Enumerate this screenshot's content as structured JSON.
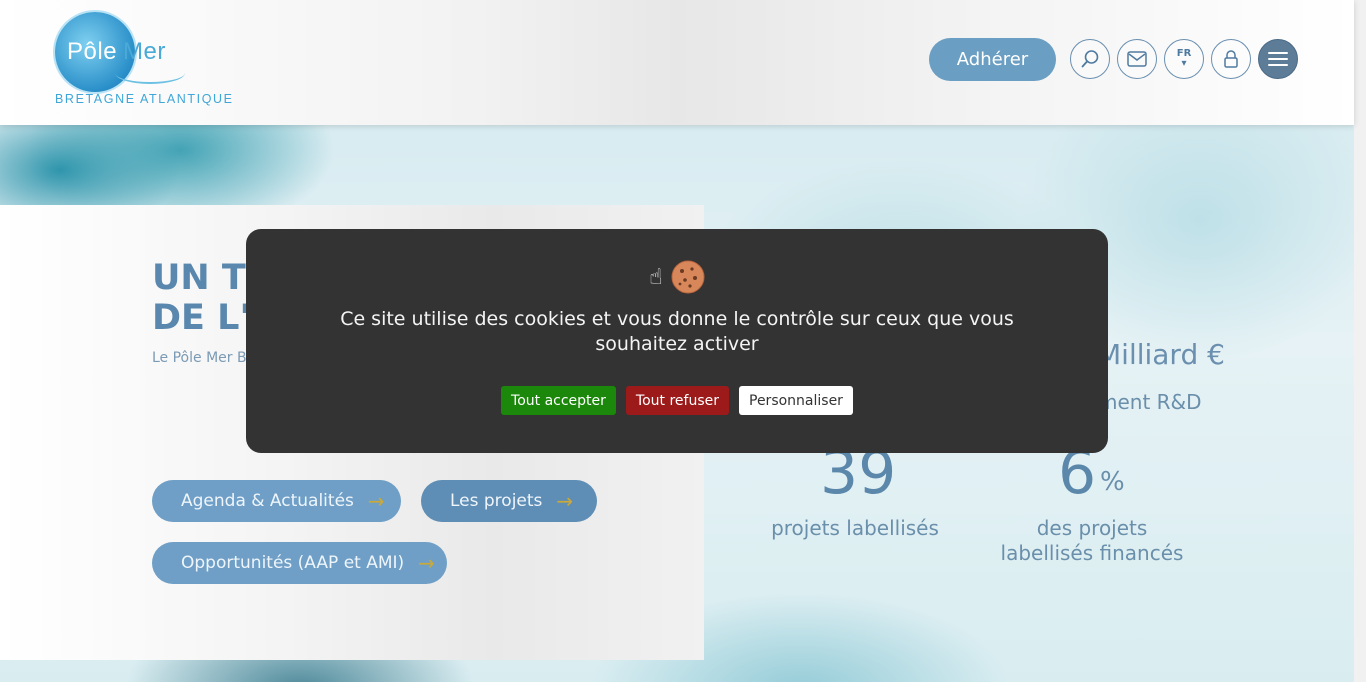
{
  "header": {
    "logo": {
      "brand_pole": "Pôle",
      "brand_mer": "Mer",
      "subtitle": "BRETAGNE ATLANTIQUE"
    },
    "nav": {
      "adherer_label": "Adhérer",
      "language_label": "FR",
      "icons": [
        "search-icon",
        "mail-icon",
        "language-icon",
        "lock-icon",
        "menu-icon"
      ]
    }
  },
  "hero": {
    "title_line1": "UN TE",
    "title_line2": "DE L'I",
    "description": "Le Pôle Mer Br (entreprises, a projet d'innova marchés.",
    "buttons": {
      "agenda": "Agenda & Actualités",
      "projets": "Les projets",
      "opportunites": "Opportunités (AAP et AMI)"
    }
  },
  "stats": {
    "milliard": "Milliard €",
    "rd": "ment R&D",
    "projets_value": "39",
    "projets_label": "projets labellisés",
    "finances_value": "6",
    "finances_unit": "%",
    "finances_label": "des projets labellisés financés"
  },
  "cookie_banner": {
    "message": "Ce site utilise des cookies et vous donne le contrôle sur ceux que vous souhaitez activer",
    "accept_label": "Tout accepter",
    "deny_label": "Tout refuser",
    "customize_label": "Personnaliser"
  },
  "colors": {
    "accent": "#6a9ec2",
    "modal_bg": "#333333",
    "accept_green": "#1b870b",
    "deny_red": "#9c1a1a"
  }
}
